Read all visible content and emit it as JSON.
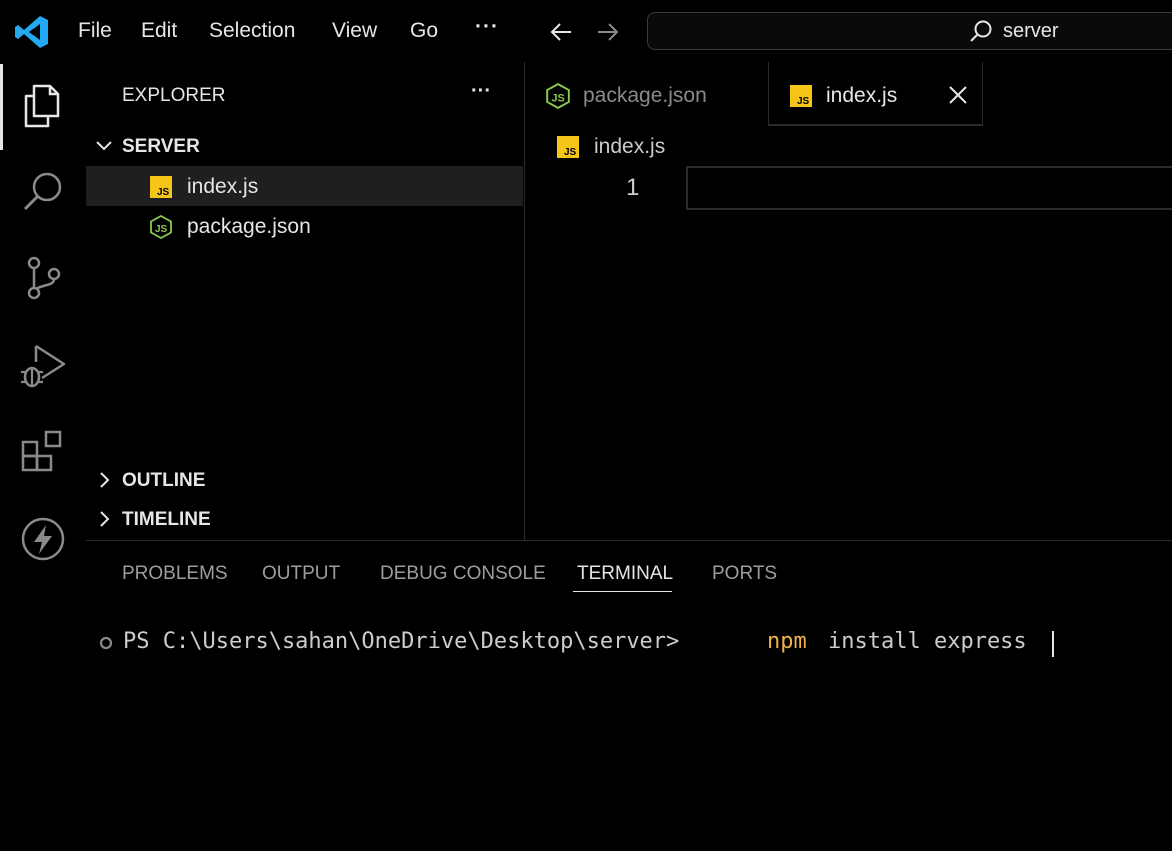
{
  "menu": {
    "file": "File",
    "edit": "Edit",
    "selection": "Selection",
    "view": "View",
    "go": "Go",
    "more": "···"
  },
  "search": {
    "text": "server"
  },
  "sidebar": {
    "title": "EXPLORER",
    "more": "···",
    "folder": "SERVER",
    "files": [
      {
        "name": "index.js",
        "icon": "js-file-icon"
      },
      {
        "name": "package.json",
        "icon": "node-json-file-icon"
      }
    ],
    "outline": "OUTLINE",
    "timeline": "TIMELINE"
  },
  "tabs": [
    {
      "label": "package.json",
      "icon": "node-json-file-icon",
      "active": false
    },
    {
      "label": "index.js",
      "icon": "js-file-icon",
      "active": true
    }
  ],
  "editor": {
    "breadcrumb": "index.js",
    "line_number": "1"
  },
  "panel": {
    "tabs": [
      "PROBLEMS",
      "OUTPUT",
      "DEBUG CONSOLE",
      "TERMINAL",
      "PORTS"
    ],
    "active_tab": "TERMINAL"
  },
  "terminal": {
    "prompt": "PS C:\\Users\\sahan\\OneDrive\\Desktop\\server>",
    "command": "npm",
    "args": "install express"
  },
  "colors": {
    "accent_blue": "#23a9f2",
    "js_yellow": "#f5c518",
    "node_green": "#8cc84b",
    "command_orange": "#f0b04a"
  }
}
